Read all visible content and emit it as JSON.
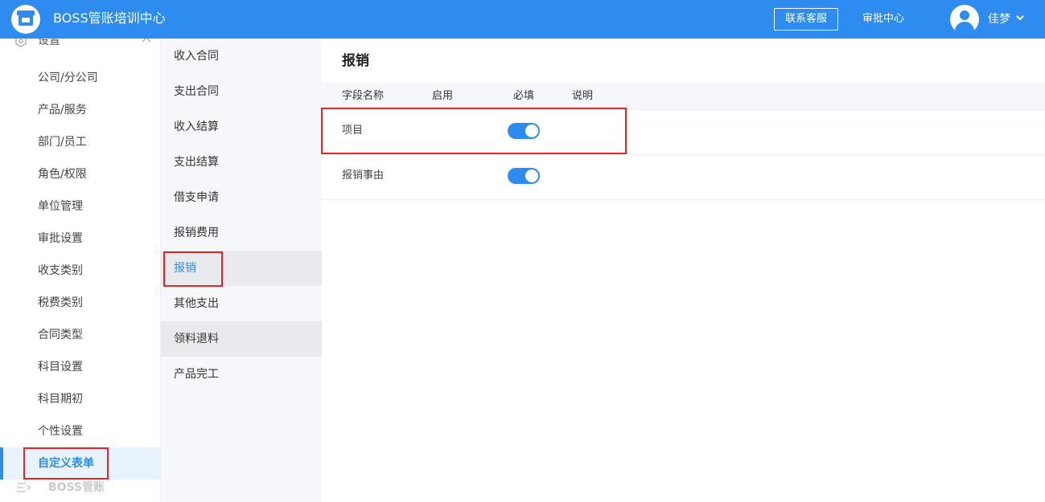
{
  "app": {
    "title": "BOSS管账培训中心"
  },
  "header": {
    "contact_button": "联系客服",
    "approval_link": "审批中心",
    "user_name": "佳梦"
  },
  "sidebar": {
    "section_label": "设置",
    "items": [
      {
        "label": "公司/分公司"
      },
      {
        "label": "产品/服务"
      },
      {
        "label": "部门/员工"
      },
      {
        "label": "角色/权限"
      },
      {
        "label": "单位管理"
      },
      {
        "label": "审批设置"
      },
      {
        "label": "收支类别"
      },
      {
        "label": "税费类别"
      },
      {
        "label": "合同类型"
      },
      {
        "label": "科目设置"
      },
      {
        "label": "科目期初"
      },
      {
        "label": "个性设置"
      },
      {
        "label": "自定义表单",
        "active": true
      }
    ],
    "footer_label": "BOSS管账"
  },
  "subnav": {
    "items": [
      {
        "label": "收入合同"
      },
      {
        "label": "支出合同"
      },
      {
        "label": "收入结算"
      },
      {
        "label": "支出结算"
      },
      {
        "label": "借支申请"
      },
      {
        "label": "报销费用"
      },
      {
        "label": "报销",
        "active": true
      },
      {
        "label": "其他支出"
      },
      {
        "label": "领料退料"
      },
      {
        "label": "产品完工"
      }
    ]
  },
  "main": {
    "title": "报销",
    "columns": {
      "field_name": "字段名称",
      "enabled": "启用",
      "required": "必填",
      "description": "说明"
    },
    "rows": [
      {
        "name": "项目",
        "required": true
      },
      {
        "name": "报销事由",
        "required": true
      }
    ]
  },
  "colors": {
    "primary": "#2e8cf0",
    "highlight": "#e6252a",
    "subnav_bg": "#f5f7fa"
  },
  "icons": {
    "logo": "shop-icon",
    "avatar": "user-avatar-icon",
    "dropdown": "chevron-down-icon",
    "settings": "gear-icon",
    "collapse": "chevron-up-icon",
    "footer": "menu-icon"
  }
}
